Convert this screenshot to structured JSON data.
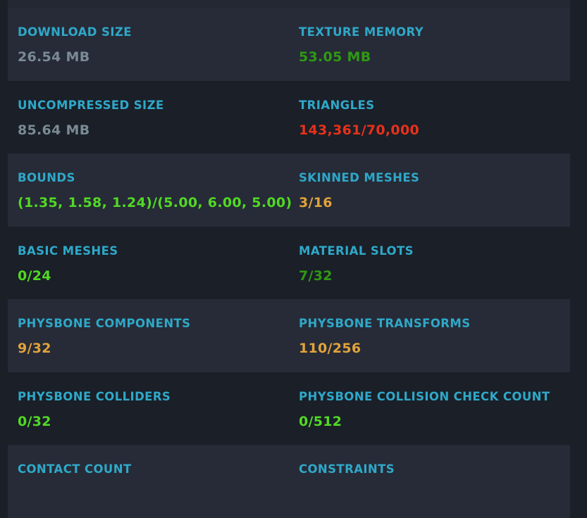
{
  "colors": {
    "background": "#1a1f28",
    "row_shaded": "#262b37",
    "label": "#2fa8c8",
    "gray": "#7a8a94",
    "green": "#52d924",
    "dark_green": "#2f9a14",
    "red": "#e8311a",
    "orange": "#e2a33a"
  },
  "stats": {
    "download_size": {
      "label": "DOWNLOAD SIZE",
      "value": "26.54 MB"
    },
    "texture_memory": {
      "label": "TEXTURE MEMORY",
      "value": "53.05 MB"
    },
    "uncompressed_size": {
      "label": "UNCOMPRESSED SIZE",
      "value": "85.64 MB"
    },
    "triangles": {
      "label": "TRIANGLES",
      "value": "143,361/70,000"
    },
    "bounds": {
      "label": "BOUNDS",
      "value": "(1.35, 1.58, 1.24)/(5.00, 6.00, 5.00)"
    },
    "skinned_meshes": {
      "label": "SKINNED MESHES",
      "value": "3/16"
    },
    "basic_meshes": {
      "label": "BASIC MESHES",
      "value": "0/24"
    },
    "material_slots": {
      "label": "MATERIAL SLOTS",
      "value": "7/32"
    },
    "physbone_components": {
      "label": "PHYSBONE COMPONENTS",
      "value": "9/32"
    },
    "physbone_transforms": {
      "label": "PHYSBONE TRANSFORMS",
      "value": "110/256"
    },
    "physbone_colliders": {
      "label": "PHYSBONE COLLIDERS",
      "value": "0/32"
    },
    "physbone_collision_check_count": {
      "label": "PHYSBONE COLLISION CHECK COUNT",
      "value": "0/512"
    },
    "contact_count": {
      "label": "CONTACT COUNT"
    },
    "constraints": {
      "label": "CONSTRAINTS"
    }
  }
}
